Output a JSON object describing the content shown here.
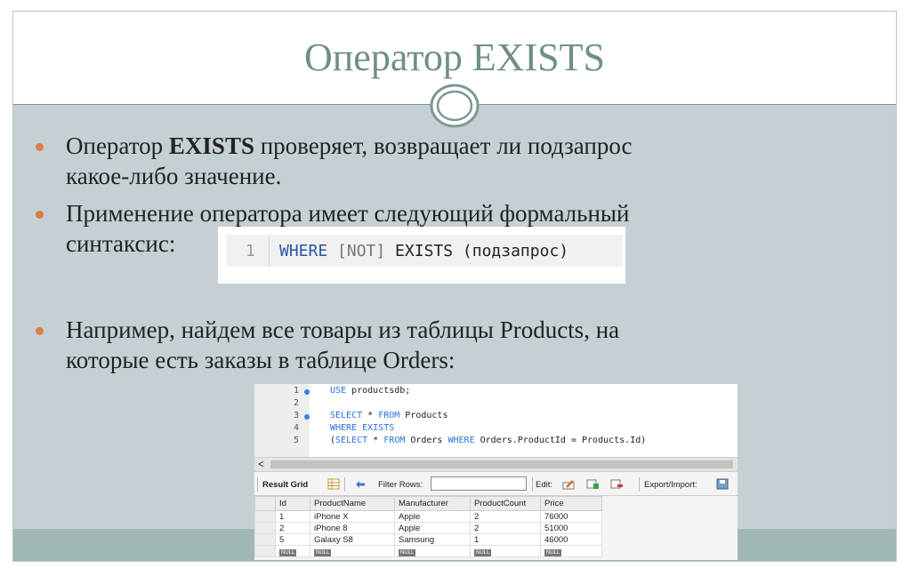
{
  "slide": {
    "title": "Оператор EXISTS",
    "bullets": [
      {
        "lines": [
          [
            {
              "text": "Оператор ",
              "bold": false
            },
            {
              "text": "EXISTS",
              "bold": true
            },
            {
              "text": " проверяет, возвращает ли подзапрос",
              "bold": false
            }
          ],
          [
            {
              "text": "какое-либо значение.",
              "bold": false
            }
          ]
        ]
      },
      {
        "lines": [
          [
            {
              "text": "Применение оператора имеет следующий формальный",
              "bold": false
            }
          ],
          [
            {
              "text": "синтаксис:",
              "bold": false
            }
          ]
        ]
      },
      {
        "lines": [
          [
            {
              "text": "Например, найдем все товары из таблицы Products, на",
              "bold": false
            }
          ],
          [
            {
              "text": "которые есть заказы в таблице Orders:",
              "bold": false
            }
          ]
        ]
      }
    ]
  },
  "syntax_box": {
    "line_number": "1",
    "tokens": [
      {
        "text": "WHERE ",
        "style": "blue"
      },
      {
        "text": "[NOT]",
        "style": "gray"
      },
      {
        "text": " EXISTS (подзапрос)",
        "style": "plain"
      }
    ]
  },
  "workbench": {
    "editor_lines": [
      {
        "num": "1",
        "marker": true,
        "tokens": [
          {
            "text": "USE ",
            "kw": true
          },
          {
            "text": "productsdb;",
            "kw": false
          }
        ]
      },
      {
        "num": "2",
        "marker": false,
        "tokens": []
      },
      {
        "num": "3",
        "marker": true,
        "tokens": [
          {
            "text": "SELECT",
            "kw": true
          },
          {
            "text": " * ",
            "kw": false
          },
          {
            "text": "FROM",
            "kw": true
          },
          {
            "text": " Products",
            "kw": false
          }
        ]
      },
      {
        "num": "4",
        "marker": false,
        "tokens": [
          {
            "text": "WHERE EXISTS",
            "kw": true
          }
        ]
      },
      {
        "num": "5",
        "marker": false,
        "tokens": [
          {
            "text": "(",
            "kw": false
          },
          {
            "text": "SELECT",
            "kw": true
          },
          {
            "text": " * ",
            "kw": false
          },
          {
            "text": "FROM",
            "kw": true
          },
          {
            "text": " Orders ",
            "kw": false
          },
          {
            "text": "WHERE",
            "kw": true
          },
          {
            "text": " Orders.ProductId = Products.Id)",
            "kw": false
          }
        ]
      }
    ],
    "scroll_arrow": "<",
    "toolbar": {
      "result_grid_label": "Result Grid",
      "filter_rows_label": "Filter Rows:",
      "edit_label": "Edit:",
      "export_label": "Export/Import:"
    },
    "grid": {
      "columns": [
        "Id",
        "ProductName",
        "Manufacturer",
        "ProductCount",
        "Price"
      ],
      "rows": [
        [
          "1",
          "iPhone X",
          "Apple",
          "2",
          "76000"
        ],
        [
          "2",
          "iPhone 8",
          "Apple",
          "2",
          "51000"
        ],
        [
          "5",
          "Galaxy S8",
          "Samsung",
          "1",
          "46000"
        ]
      ],
      "null_label": "NULL"
    },
    "icons": [
      "grid-icon",
      "refresh-icon",
      "edit-row-icon",
      "add-row-icon",
      "delete-row-icon",
      "export-icon"
    ]
  },
  "colors": {
    "title": "#6f8f89",
    "content_bg": "#c5d0d5",
    "bottom_band": "#9fb7b5",
    "bullet_dot": "#e07a43",
    "sql_keyword": "#2874d8"
  }
}
